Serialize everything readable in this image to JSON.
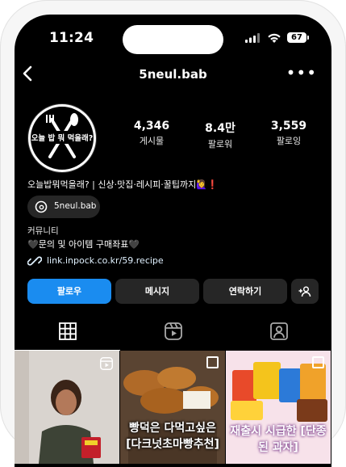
{
  "status_bar": {
    "time": "11:24",
    "battery": "67"
  },
  "header": {
    "username": "5neul.bab"
  },
  "profile": {
    "avatar_text": "오늘 밥 뭐 먹을래?",
    "stats": [
      {
        "value": "4,346",
        "label": "게시물"
      },
      {
        "value": "8.4만",
        "label": "팔로워"
      },
      {
        "value": "3,559",
        "label": "팔로잉"
      }
    ],
    "bio": "오늘밥뭐먹을래? | 신상·맛집·레시피·꿀팁까지🙋‍♀️❗",
    "threads_handle": "5neul.bab",
    "category": "커뮤니티",
    "bio_line2": "🖤문의 및 아이템 구매좌표🖤",
    "link": "link.inpock.co.kr/59.recipe"
  },
  "actions": {
    "follow": "팔로우",
    "message": "메시지",
    "contact": "연락하기"
  },
  "tabs": [
    "grid-icon",
    "reels-icon",
    "tagged-icon"
  ],
  "posts": [
    {
      "type": "reel",
      "caption": ""
    },
    {
      "type": "carousel",
      "caption": "빵덕은 다먹고싶은 [다크넛초마빵추천]"
    },
    {
      "type": "carousel",
      "caption": "재출시 시급한 [단종된 과자]"
    }
  ],
  "colors": {
    "background": "#000000",
    "primary_button": "#1a8cf0",
    "secondary_button": "#262626"
  }
}
